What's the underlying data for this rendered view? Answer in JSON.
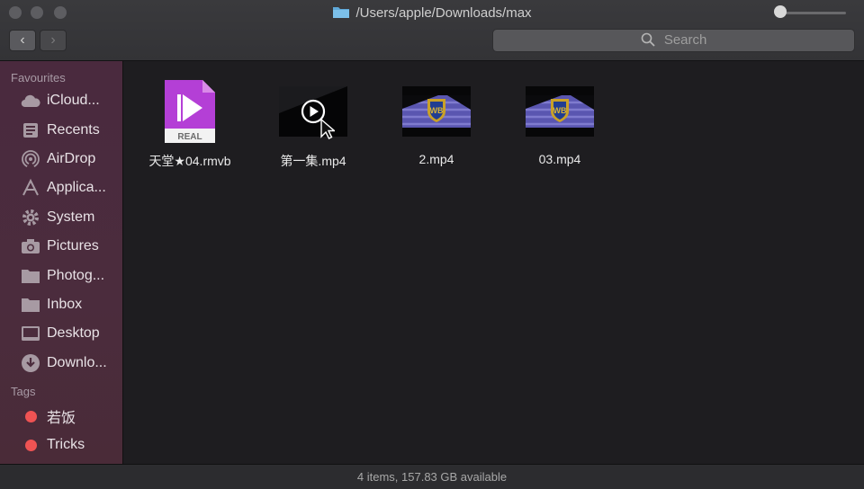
{
  "window": {
    "title": "/Users/apple/Downloads/max"
  },
  "toolbar": {
    "back": "‹",
    "forward": "›",
    "search_placeholder": "Search"
  },
  "sidebar": {
    "favourites_label": "Favourites",
    "items": [
      {
        "label": "iCloud...",
        "icon": "cloud-icon"
      },
      {
        "label": "Recents",
        "icon": "recents-icon"
      },
      {
        "label": "AirDrop",
        "icon": "airdrop-icon"
      },
      {
        "label": "Applica...",
        "icon": "applications-icon"
      },
      {
        "label": "System",
        "icon": "gear-icon"
      },
      {
        "label": "Pictures",
        "icon": "camera-icon"
      },
      {
        "label": "Photog...",
        "icon": "folder-icon"
      },
      {
        "label": "Inbox",
        "icon": "folder-icon"
      },
      {
        "label": "Desktop",
        "icon": "desktop-icon"
      },
      {
        "label": "Downlo...",
        "icon": "download-icon"
      }
    ],
    "tags_label": "Tags",
    "tags": [
      {
        "label": "若饭",
        "color": "#ef5353"
      },
      {
        "label": "Tricks",
        "color": "#ef5353"
      }
    ]
  },
  "files": [
    {
      "name": "天堂★04.rmvb",
      "type": "real",
      "badge": "REAL"
    },
    {
      "name": "第一集.mp4",
      "type": "video-dark"
    },
    {
      "name": "2.mp4",
      "type": "video-wb"
    },
    {
      "name": "03.mp4",
      "type": "video-wb"
    }
  ],
  "status": {
    "text": "4 items, 157.83 GB available"
  },
  "colors": {
    "sidebar": "#4b2c3d",
    "main_bg": "#1e1d20",
    "tag_red": "#ef5353",
    "real_purple": "#b43fd6"
  }
}
